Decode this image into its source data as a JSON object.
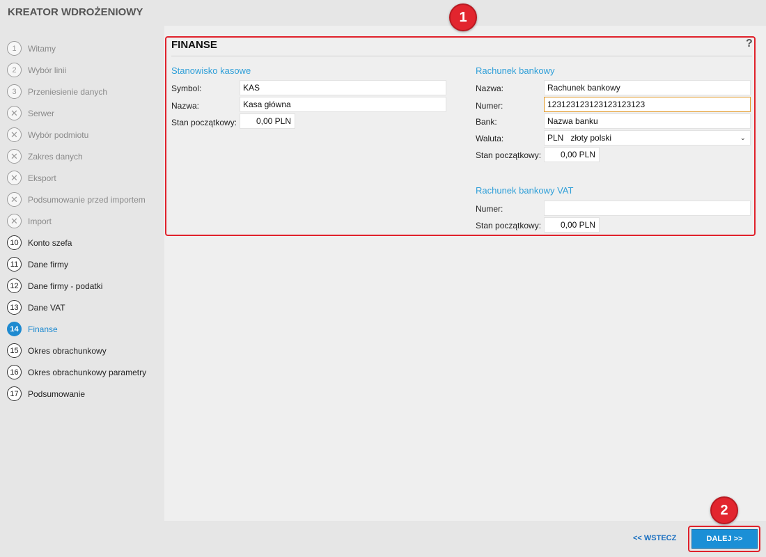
{
  "app": {
    "title": "KREATOR WDROŻENIOWY"
  },
  "steps": [
    {
      "num": "1",
      "label": "Witamy",
      "state": "done"
    },
    {
      "num": "2",
      "label": "Wybór linii",
      "state": "done"
    },
    {
      "num": "3",
      "label": "Przeniesienie danych",
      "state": "done"
    },
    {
      "num": "✕",
      "label": "Serwer",
      "state": "skipped"
    },
    {
      "num": "✕",
      "label": "Wybór podmiotu",
      "state": "skipped"
    },
    {
      "num": "✕",
      "label": "Zakres danych",
      "state": "skipped"
    },
    {
      "num": "✕",
      "label": "Eksport",
      "state": "skipped"
    },
    {
      "num": "✕",
      "label": "Podsumowanie przed importem",
      "state": "skipped"
    },
    {
      "num": "✕",
      "label": "Import",
      "state": "skipped"
    },
    {
      "num": "10",
      "label": "Konto szefa",
      "state": "pending"
    },
    {
      "num": "11",
      "label": "Dane firmy",
      "state": "pending"
    },
    {
      "num": "12",
      "label": "Dane firmy - podatki",
      "state": "pending"
    },
    {
      "num": "13",
      "label": "Dane VAT",
      "state": "pending"
    },
    {
      "num": "14",
      "label": "Finanse",
      "state": "active"
    },
    {
      "num": "15",
      "label": "Okres obrachunkowy",
      "state": "pending"
    },
    {
      "num": "16",
      "label": "Okres obrachunkowy parametry",
      "state": "pending"
    },
    {
      "num": "17",
      "label": "Podsumowanie",
      "state": "pending"
    }
  ],
  "panel": {
    "title": "FINANSE",
    "help": "?",
    "cash": {
      "heading": "Stanowisko kasowe",
      "symbol_label": "Symbol:",
      "symbol_value": "KAS",
      "name_label": "Nazwa:",
      "name_value": "Kasa główna",
      "balance_label": "Stan początkowy:",
      "balance_value": "0,00 PLN"
    },
    "bank": {
      "heading": "Rachunek bankowy",
      "name_label": "Nazwa:",
      "name_value": "Rachunek bankowy",
      "number_label": "Numer:",
      "number_value": "123123123123123123123",
      "bank_label": "Bank:",
      "bank_value": "Nazwa banku",
      "currency_label": "Waluta:",
      "currency_code": "PLN",
      "currency_name": "złoty polski",
      "balance_label": "Stan początkowy:",
      "balance_value": "0,00 PLN"
    },
    "vat": {
      "heading": "Rachunek bankowy VAT",
      "number_label": "Numer:",
      "number_value": "",
      "balance_label": "Stan początkowy:",
      "balance_value": "0,00 PLN"
    }
  },
  "footer": {
    "back_label": "<< WSTECZ",
    "next_label": "DALEJ >>"
  },
  "badges": {
    "one": "1",
    "two": "2"
  },
  "colors": {
    "accent": "#1e8ad0",
    "highlight": "#e0212b"
  }
}
